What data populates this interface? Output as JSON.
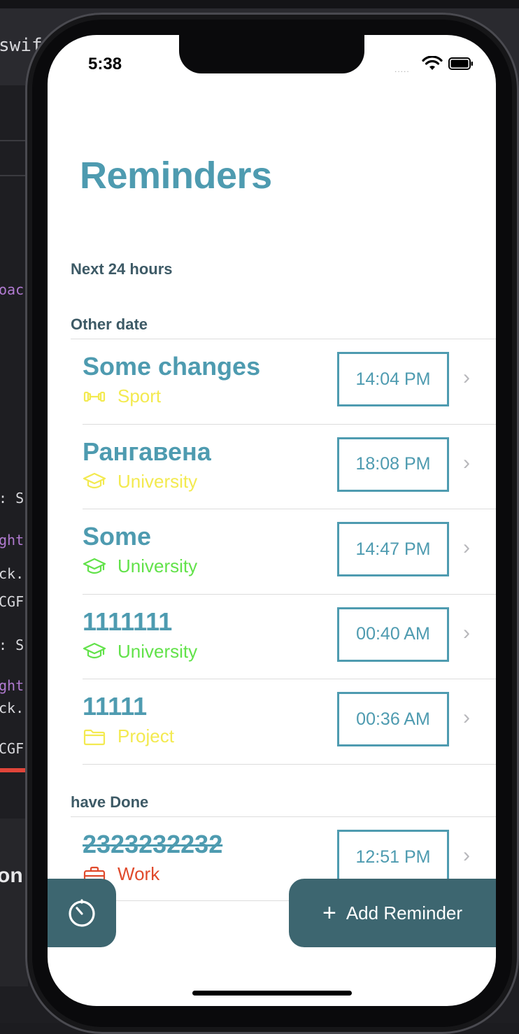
{
  "editor": {
    "tab_title": "swif",
    "fragments": [
      {
        "text": "oac",
        "color": "#b07ad0"
      },
      {
        "text": ": S",
        "color": "#d8d8dc"
      },
      {
        "text": "ght",
        "color": "#b07ad0"
      },
      {
        "text": "ck.",
        "color": "#d8d8dc"
      },
      {
        "text": "CGF",
        "color": "#d8d8dc"
      },
      {
        "text": ": S",
        "color": "#d8d8dc"
      },
      {
        "text": "ght",
        "color": "#b07ad0"
      },
      {
        "text": "ck.",
        "color": "#d8d8dc"
      },
      {
        "text": "CGF",
        "color": "#d8d8dc"
      }
    ],
    "lower_text": "on"
  },
  "status_bar": {
    "time": "5:38",
    "signal": "....."
  },
  "page_title": "Reminders",
  "sections": {
    "next_24": "Next 24 hours",
    "other_date": "Other date",
    "have_done": "have Done"
  },
  "reminders": [
    {
      "title": "Some changes",
      "category": "Sport",
      "icon": "dumbbell-icon",
      "color": "#f3ea50",
      "time": "14:04 PM"
    },
    {
      "title": "Рангавена",
      "category": "University",
      "icon": "graduation-cap-icon",
      "color": "#f3ea50",
      "time": "18:08 PM"
    },
    {
      "title": "Some",
      "category": "University",
      "icon": "graduation-cap-icon",
      "color": "#62e24a",
      "time": "14:47 PM"
    },
    {
      "title": "1111111",
      "category": "University",
      "icon": "graduation-cap-icon",
      "color": "#62e24a",
      "time": "00:40 AM"
    },
    {
      "title": "11111",
      "category": "Project",
      "icon": "folder-icon",
      "color": "#f3ea50",
      "time": "00:36 AM"
    }
  ],
  "done_reminders": [
    {
      "title": "2323232232",
      "category": "Work",
      "icon": "briefcase-icon",
      "color": "#e04a2c",
      "time": "12:51 PM"
    }
  ],
  "buttons": {
    "timer_icon": "stopwatch-icon",
    "add_label": "Add Reminder"
  },
  "colors": {
    "accent": "#4e9bb0",
    "button": "#3d6670"
  }
}
